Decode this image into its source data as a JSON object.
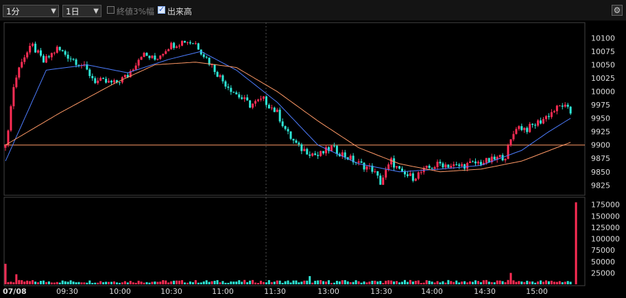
{
  "toolbar": {
    "interval_select": "1分",
    "period_select": "1日",
    "log_scale": {
      "label": "終値3%幅",
      "checked": false
    },
    "show_ohlc": {
      "label": "出来高",
      "checked": true
    },
    "settings_icon": "gear-icon"
  },
  "chart_data": [
    {
      "type": "candlestick",
      "date_label": "07/08",
      "x_tick_labels": [
        "09:30",
        "10:00",
        "10:30",
        "11:00",
        "11:30",
        "13:00",
        "13:30",
        "14:00",
        "14:30",
        "15:00"
      ],
      "price_axis": {
        "ticks": [
          9825,
          9850,
          9875,
          9900,
          9925,
          9950,
          9975,
          10000,
          10025,
          10050,
          10075,
          10100
        ],
        "range": [
          9810,
          10125
        ]
      },
      "reference_line": 9900,
      "colors": {
        "up": "#ff2d55",
        "down": "#2ee6d6",
        "ma_short": "#4d7dff",
        "ma_long": "#ff9966",
        "reference": "#ff9966"
      },
      "close_path": [
        [
          0,
          9895
        ],
        [
          3,
          10010
        ],
        [
          6,
          10060
        ],
        [
          10,
          10085
        ],
        [
          14,
          10055
        ],
        [
          19,
          10080
        ],
        [
          22,
          10070
        ],
        [
          28,
          10050
        ],
        [
          33,
          10020
        ],
        [
          40,
          10015
        ],
        [
          45,
          10030
        ],
        [
          50,
          10070
        ],
        [
          55,
          10060
        ],
        [
          60,
          10085
        ],
        [
          66,
          10095
        ],
        [
          70,
          10090
        ],
        [
          75,
          10055
        ],
        [
          80,
          10020
        ],
        [
          85,
          9995
        ],
        [
          90,
          9975
        ],
        [
          95,
          9985
        ],
        [
          100,
          9960
        ],
        [
          104,
          9920
        ],
        [
          108,
          9895
        ],
        [
          115,
          9880
        ],
        [
          120,
          9895
        ],
        [
          125,
          9880
        ],
        [
          130,
          9865
        ],
        [
          135,
          9855
        ],
        [
          138,
          9830
        ],
        [
          142,
          9870
        ],
        [
          146,
          9845
        ],
        [
          150,
          9840
        ],
        [
          155,
          9855
        ],
        [
          160,
          9865
        ],
        [
          166,
          9860
        ],
        [
          172,
          9865
        ],
        [
          178,
          9870
        ],
        [
          184,
          9880
        ],
        [
          188,
          9935
        ],
        [
          192,
          9930
        ],
        [
          197,
          9945
        ],
        [
          202,
          9965
        ],
        [
          205,
          9975
        ],
        [
          208,
          9960
        ]
      ],
      "ma_short": [
        [
          0,
          9870
        ],
        [
          15,
          10040
        ],
        [
          30,
          10050
        ],
        [
          45,
          10035
        ],
        [
          60,
          10060
        ],
        [
          72,
          10075
        ],
        [
          85,
          10040
        ],
        [
          100,
          9980
        ],
        [
          115,
          9900
        ],
        [
          130,
          9865
        ],
        [
          145,
          9850
        ],
        [
          160,
          9855
        ],
        [
          175,
          9862
        ],
        [
          190,
          9890
        ],
        [
          200,
          9925
        ],
        [
          208,
          9950
        ]
      ],
      "ma_long": [
        [
          0,
          9900
        ],
        [
          20,
          9960
        ],
        [
          40,
          10015
        ],
        [
          55,
          10050
        ],
        [
          70,
          10055
        ],
        [
          85,
          10045
        ],
        [
          100,
          10000
        ],
        [
          115,
          9945
        ],
        [
          130,
          9895
        ],
        [
          145,
          9865
        ],
        [
          160,
          9850
        ],
        [
          175,
          9855
        ],
        [
          190,
          9870
        ],
        [
          208,
          9905
        ]
      ]
    },
    {
      "type": "bar",
      "series_name": "volume",
      "y_tick_labels": [
        175000,
        150000,
        125000,
        100000,
        75000,
        50000,
        25000
      ],
      "y_range": [
        0,
        185000
      ],
      "notable_values": [
        {
          "x": 0,
          "value": 45000
        },
        {
          "x": 4,
          "value": 22000
        },
        {
          "x": 112,
          "value": 18000
        },
        {
          "x": 186,
          "value": 25000
        },
        {
          "x": 210,
          "value": 180000
        }
      ]
    }
  ]
}
